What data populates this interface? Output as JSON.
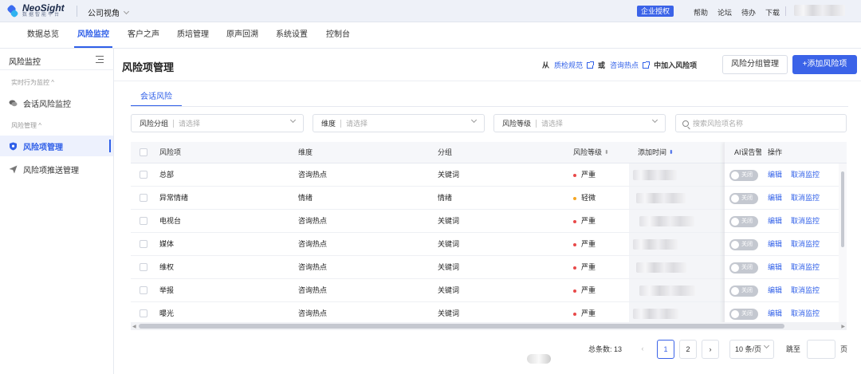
{
  "brand": {
    "name": "NeoSight",
    "tagline": "数据智能平台"
  },
  "company_switch": "公司视角",
  "enterprise_badge": "企业授权",
  "top_links": [
    "帮助",
    "论坛",
    "待办",
    "下载"
  ],
  "nav": [
    "数据总览",
    "风险监控",
    "客户之声",
    "质培管理",
    "原声回溯",
    "系统设置",
    "控制台"
  ],
  "sidebar": {
    "title": "风险监控",
    "groups": [
      {
        "label": "实时行为监控 ^",
        "items": [
          "会话风险监控"
        ]
      },
      {
        "label": "风险管理 ^",
        "items": [
          "风险项管理",
          "风险项推送管理"
        ]
      }
    ]
  },
  "page": {
    "title": "风险项管理",
    "from_text": "从",
    "link1": "质检规范",
    "or_text": "或",
    "link2": "咨询热点",
    "add_into_text": "中加入风险项",
    "group_manage_button": "风险分组管理",
    "add_button": "+添加风险项"
  },
  "tab": "会话风险",
  "filters": {
    "group": {
      "label": "风险分组",
      "placeholder": "请选择"
    },
    "dimension": {
      "label": "维度",
      "placeholder": "请选择"
    },
    "level": {
      "label": "风险等级",
      "placeholder": "请选择"
    },
    "search_placeholder": "搜索风险项名称"
  },
  "table": {
    "headers": {
      "item": "风险项",
      "dimension": "维度",
      "group": "分组",
      "level": "风险等级",
      "time": "添加时间",
      "ai": "AI误告警",
      "ops": "操作"
    },
    "rows": [
      {
        "item": "总部",
        "dimension": "咨询热点",
        "group": "关键词",
        "level": "严重",
        "level_color": "#e84a4a",
        "toggle": "关闭"
      },
      {
        "item": "异常情绪",
        "dimension": "情绪",
        "group": "情绪",
        "level": "轻微",
        "level_color": "#f5a623",
        "toggle": "关闭"
      },
      {
        "item": "电视台",
        "dimension": "咨询热点",
        "group": "关键词",
        "level": "严重",
        "level_color": "#e84a4a",
        "toggle": "关闭"
      },
      {
        "item": "媒体",
        "dimension": "咨询热点",
        "group": "关键词",
        "level": "严重",
        "level_color": "#e84a4a",
        "toggle": "关闭"
      },
      {
        "item": "维权",
        "dimension": "咨询热点",
        "group": "关键词",
        "level": "严重",
        "level_color": "#e84a4a",
        "toggle": "关闭"
      },
      {
        "item": "举报",
        "dimension": "咨询热点",
        "group": "关键词",
        "level": "严重",
        "level_color": "#e84a4a",
        "toggle": "关闭"
      },
      {
        "item": "曝光",
        "dimension": "咨询热点",
        "group": "关键词",
        "level": "严重",
        "level_color": "#e84a4a",
        "toggle": "关闭"
      }
    ],
    "edit_label": "编辑",
    "cancel_label": "取消监控"
  },
  "pagination": {
    "total_label": "总条数:",
    "total": "13",
    "pages": [
      "1",
      "2"
    ],
    "current": "1",
    "page_size": "10 条/页",
    "jump_label": "跳至",
    "page_unit": "页"
  }
}
